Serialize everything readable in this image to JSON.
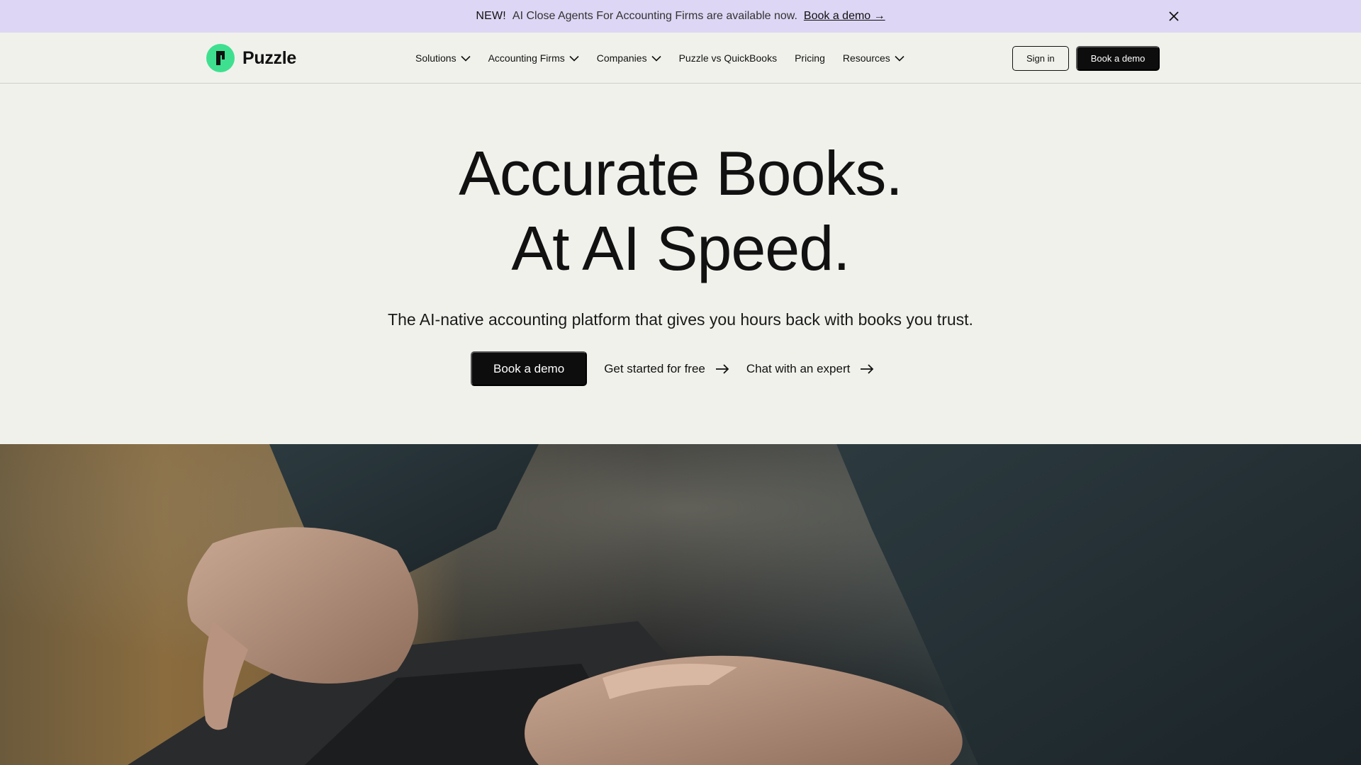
{
  "announcement": {
    "badge": "NEW!",
    "message": "AI Close Agents For Accounting Firms are available now.",
    "link_label": "Book a demo →",
    "close_icon": "close-icon"
  },
  "brand": {
    "name": "Puzzle",
    "accent": "#3ee08f"
  },
  "nav": {
    "items": [
      {
        "label": "Solutions",
        "has_dropdown": true
      },
      {
        "label": "Accounting Firms",
        "has_dropdown": true
      },
      {
        "label": "Companies",
        "has_dropdown": true
      },
      {
        "label": "Puzzle vs QuickBooks",
        "has_dropdown": false
      },
      {
        "label": "Pricing",
        "has_dropdown": false
      },
      {
        "label": "Resources",
        "has_dropdown": true
      }
    ],
    "sign_in_label": "Sign in",
    "book_demo_label": "Book a demo"
  },
  "hero": {
    "title_line1": "Accurate Books.",
    "title_line2": "At AI Speed.",
    "subtitle": "The AI-native accounting platform that gives you hours back with books you trust.",
    "primary_cta": "Book a demo",
    "secondary_cta": "Get started for free",
    "tertiary_cta": "Chat with an expert"
  },
  "colors": {
    "announcement_bg": "#ddd6f4",
    "page_bg": "#f1f1ec",
    "button_dark": "#0d0d0d"
  }
}
